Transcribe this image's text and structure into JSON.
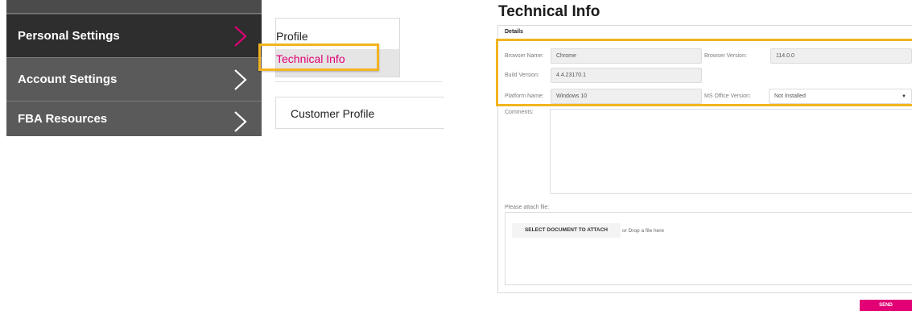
{
  "sidebar": {
    "items": [
      {
        "label": "Personal Settings",
        "active": true,
        "chevron_color": "#e20074"
      },
      {
        "label": "Account Settings",
        "active": false,
        "chevron_color": "#ffffff"
      },
      {
        "label": "FBA Resources",
        "active": false,
        "chevron_color": "#ffffff"
      }
    ]
  },
  "submenu": {
    "items": [
      {
        "label": "Profile"
      },
      {
        "label": "Technical Info",
        "selected": true
      }
    ],
    "next_card": "Customer Profile"
  },
  "technical_info": {
    "title": "Technical Info",
    "section": "Details",
    "fields": {
      "browser_name": {
        "label": "Browser Name:",
        "value": "Chrome"
      },
      "browser_version": {
        "label": "Browser Version:",
        "value": "114.0.0"
      },
      "build_version": {
        "label": "Build Version:",
        "value": "4.4.23170.1"
      },
      "platform_name": {
        "label": "Platform Name:",
        "value": "Windows 10"
      },
      "ms_office_version": {
        "label": "MS Office Version:",
        "value": "Not Installed"
      }
    },
    "comments_label": "Comments:",
    "attach_label": "Please attach file:",
    "attach_button": "SELECT DOCUMENT TO ATTACH",
    "drop_text": "or Drop a file here",
    "send_button": "SEND"
  },
  "colors": {
    "accent": "#e20074",
    "highlight": "#f2b41f",
    "sidebar_bg": "#5a5a5a",
    "sidebar_active_bg": "#2e2e2e"
  }
}
